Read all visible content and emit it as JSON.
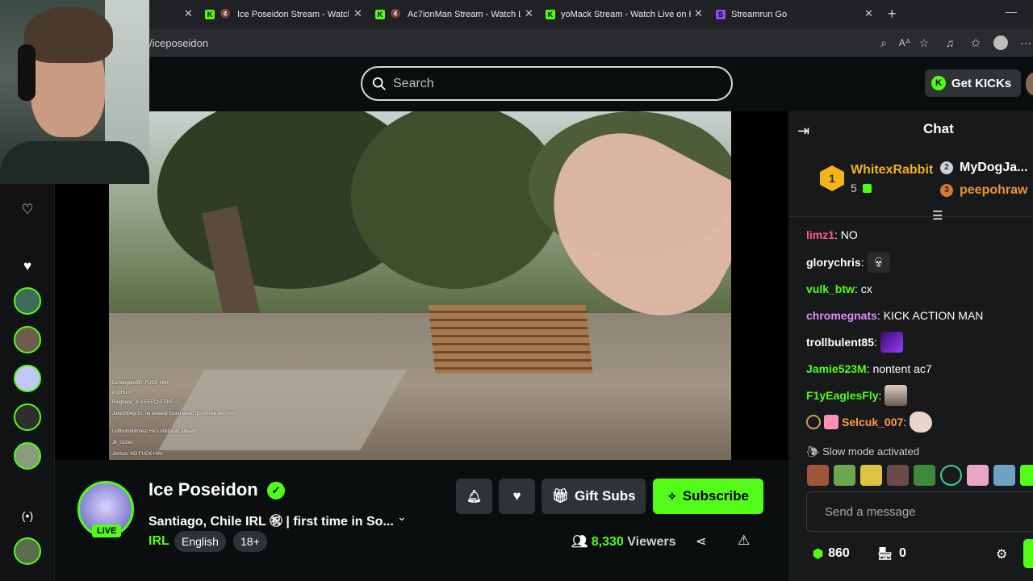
{
  "browser": {
    "tabs": [
      {
        "title": "Ice Poseidon Stream - Watch",
        "favicon": "kick-icon",
        "muted": true
      },
      {
        "title": "Ac7ionMan Stream - Watch Li",
        "favicon": "kick-icon",
        "muted": true
      },
      {
        "title": "yoMack Stream - Watch Live on Ki",
        "favicon": "kick-icon",
        "muted": false
      },
      {
        "title": "Streamrun Go",
        "favicon": "streamrun-icon",
        "muted": false
      }
    ],
    "new_tab": "+",
    "url": "/iceposeidon"
  },
  "header": {
    "search_placeholder": "Search",
    "get_kicks_label": "Get KICKs"
  },
  "video_overlay_chat": [
    "Lichtlegend90: FUCK HIM",
    "PopHum:",
    "Ringbase_3: EEEECNTENT",
    "Jukel2kt4gr1n: he already found weed go smoke with him",
    "Luftbombilirmea: He's shitfaced already",
    "Jk_rizzler: ",
    "Jimbus: NO FUCK HIM"
  ],
  "stream": {
    "name": "Ice Poseidon",
    "live_label": "LIVE",
    "title": "Santiago, Chile IRL ㊗ | first time in So...",
    "category": "IRL",
    "tags": [
      "English",
      "18+"
    ],
    "viewers_count": "8,330",
    "viewers_label": "Viewers",
    "gift_subs_label": "Gift Subs",
    "subscribe_label": "Subscribe"
  },
  "chat": {
    "title": "Chat",
    "leaderboard": [
      {
        "rank": "1",
        "name": "WhitexRabbit",
        "count": "5"
      },
      {
        "rank": "2",
        "name": "MyDogJa..."
      },
      {
        "rank": "3",
        "name": "peepohraw"
      }
    ],
    "messages": [
      {
        "user": "limz1",
        "sep": ":",
        "text": "NO",
        "color": "#ff5f8a"
      },
      {
        "user": "glorychris",
        "sep": ":",
        "text": "",
        "color": "#ffffff"
      },
      {
        "user": "vulk_btw",
        "sep": ":",
        "text": "cx",
        "color": "#53fc18"
      },
      {
        "user": "chromegnats",
        "sep": ":",
        "text": "KICK ACTION MAN",
        "color": "#e58cff"
      },
      {
        "user": "trollbulent85",
        "sep": ":",
        "text": "",
        "color": "#ffffff"
      },
      {
        "user": "Jamie523M",
        "sep": ":",
        "text": "nontent ac7",
        "color": "#53fc18"
      },
      {
        "user": "F1yEaglesFly",
        "sep": ":",
        "text": "",
        "color": "#53fc18"
      },
      {
        "user": "Selcuk_007",
        "sep": ":",
        "text": "",
        "color": "#ff9b3d"
      }
    ],
    "slow_mode": "Slow mode activated",
    "input_placeholder": "Send a message",
    "points": "860",
    "store_count": "0"
  },
  "colors": {
    "accent": "#53fc18",
    "background": "#0b0e0f",
    "chat_bg": "#18191b"
  }
}
